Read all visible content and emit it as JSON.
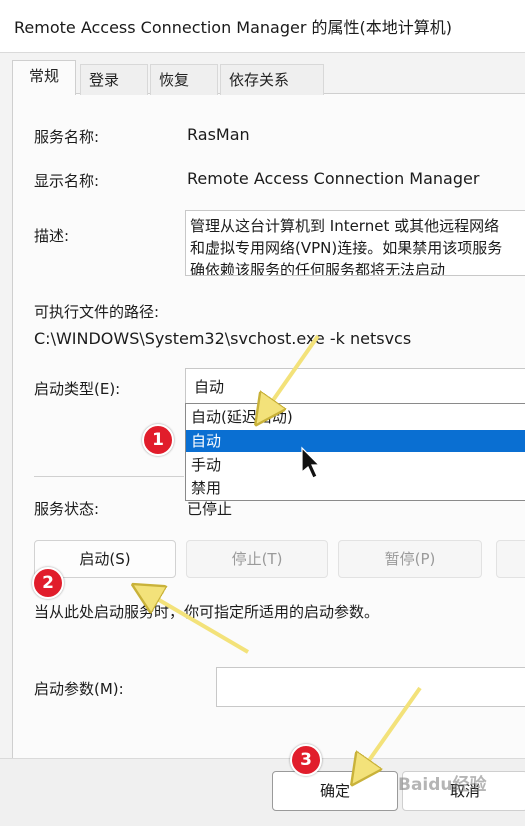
{
  "window": {
    "title": "Remote Access Connection Manager 的属性(本地计算机)"
  },
  "tabs": [
    {
      "label": "常规",
      "active": true
    },
    {
      "label": "登录",
      "active": false
    },
    {
      "label": "恢复",
      "active": false
    },
    {
      "label": "依存关系",
      "active": false
    }
  ],
  "general": {
    "service_name_label": "服务名称:",
    "service_name": "RasMan",
    "display_name_label": "显示名称:",
    "display_name": "Remote Access Connection Manager",
    "description_label": "描述:",
    "description_lines": [
      "管理从这台计算机到 Internet 或其他远程网络",
      "和虚拟专用网络(VPN)连接。如果禁用该项服务",
      "确依赖该服务的任何服务都将无法启动"
    ],
    "path_label": "可执行文件的路径:",
    "path": "C:\\WINDOWS\\System32\\svchost.exe -k netsvcs",
    "startup_type_label": "启动类型(E):",
    "startup_type_value": "自动",
    "startup_options": [
      "自动(延迟启动)",
      "自动",
      "手动",
      "禁用"
    ],
    "startup_selected_index": 1,
    "status_label": "服务状态:",
    "status_value": "已停止",
    "buttons": {
      "start": "启动(S)",
      "stop": "停止(T)",
      "pause": "暂停(P)"
    },
    "hint": "当从此处启动服务时，你可指定所适用的启动参数。",
    "params_label": "启动参数(M):",
    "params_value": ""
  },
  "footer": {
    "ok": "确定",
    "cancel": "取消"
  },
  "annotations": {
    "step1": "1",
    "step2": "2",
    "step3": "3"
  },
  "watermark": "Baidu经验",
  "colors": {
    "selection": "#0a6fd2",
    "badge": "#e11d2b",
    "arrow": "#f3e27a"
  }
}
